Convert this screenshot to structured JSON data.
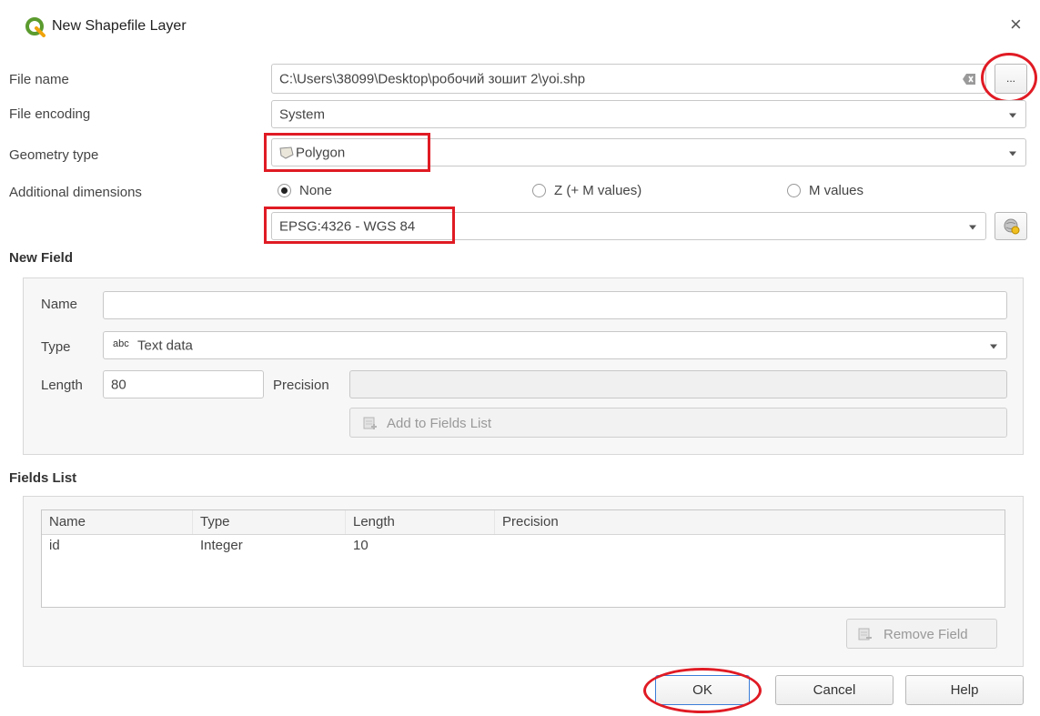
{
  "window": {
    "title": "New Shapefile Layer",
    "close_glyph": "×",
    "logo_icon": "qgis-logo-icon"
  },
  "form": {
    "file_name_label": "File name",
    "file_name_value": "C:\\Users\\38099\\Desktop\\робочий зошит 2\\yoi.shp",
    "browse_label": "...",
    "file_encoding_label": "File encoding",
    "file_encoding_value": "System",
    "geometry_type_label": "Geometry type",
    "geometry_type_value": "Polygon",
    "additional_dimensions_label": "Additional dimensions",
    "dim_options": [
      "None",
      "Z (+ M values)",
      "M values"
    ],
    "dim_selected": "None",
    "crs_value": "EPSG:4326 - WGS 84"
  },
  "new_field": {
    "title": "New Field",
    "name_label": "Name",
    "name_value": "",
    "type_label": "Type",
    "type_prefix": "abc",
    "type_value": "Text data",
    "length_label": "Length",
    "length_value": "80",
    "precision_label": "Precision",
    "precision_value": "",
    "add_button": "Add to Fields List"
  },
  "fields_list": {
    "title": "Fields List",
    "columns": [
      "Name",
      "Type",
      "Length",
      "Precision"
    ],
    "rows": [
      [
        "id",
        "Integer",
        "10",
        ""
      ]
    ],
    "remove_button": "Remove Field"
  },
  "buttons": {
    "ok": "OK",
    "cancel": "Cancel",
    "help": "Help"
  },
  "colors": {
    "highlight": "#e01b24",
    "qgis_green": "#5b9b2e"
  }
}
